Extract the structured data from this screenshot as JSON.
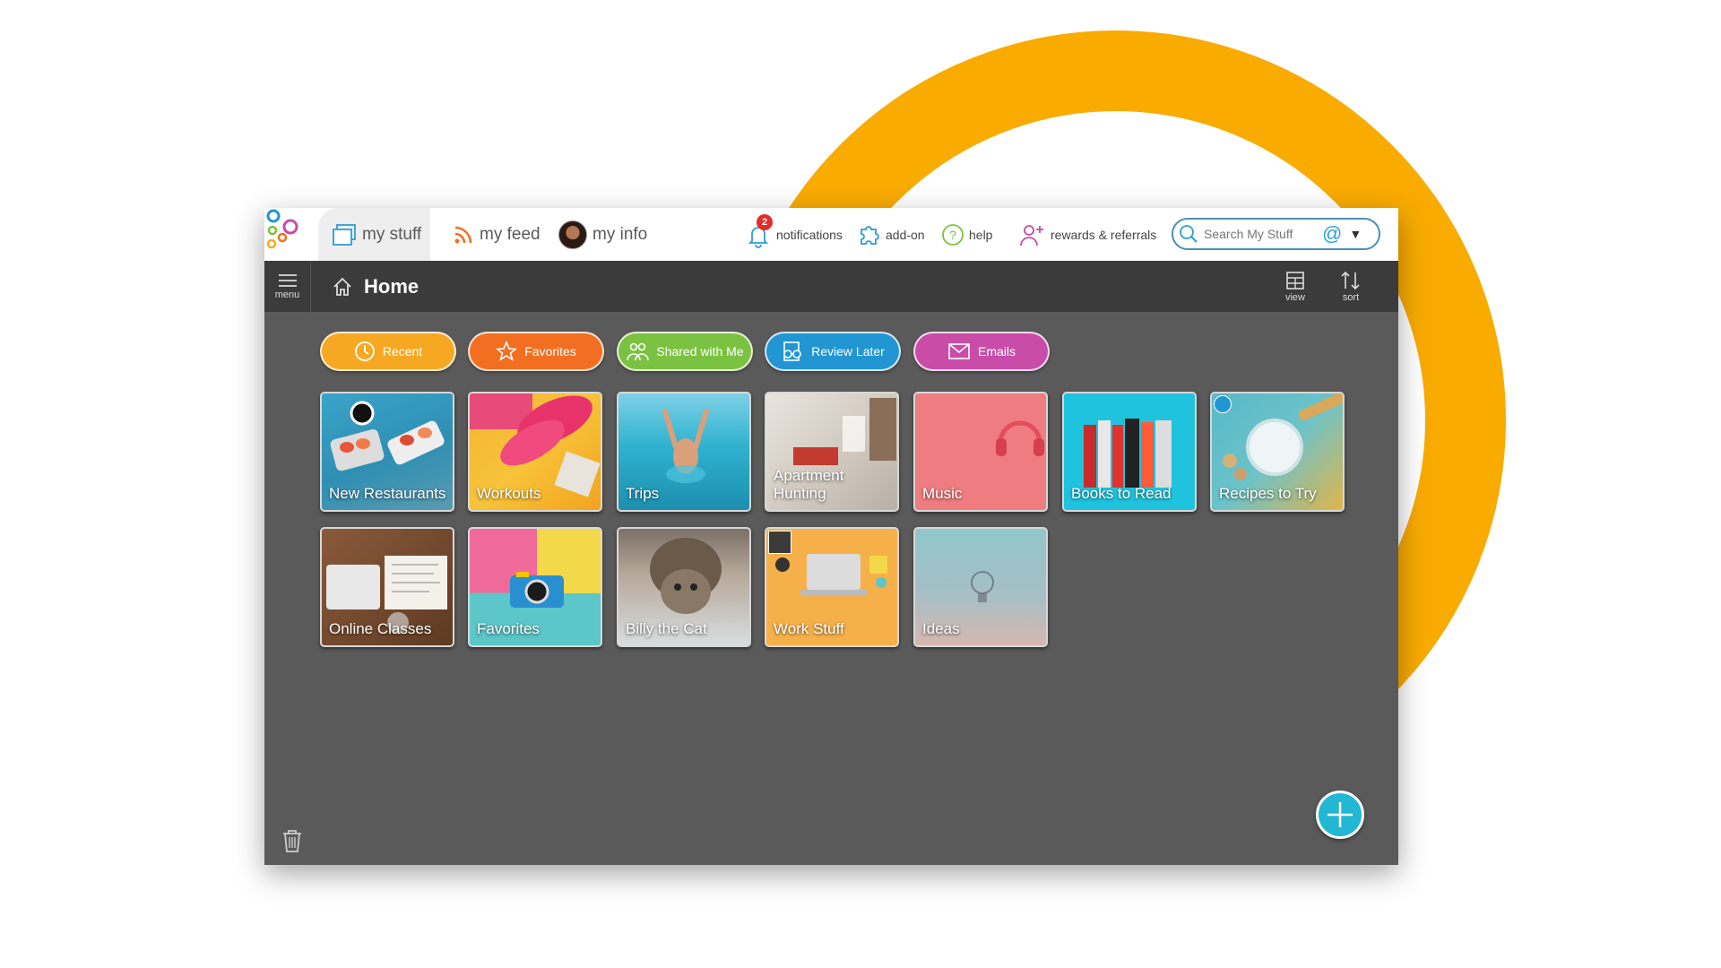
{
  "topnav": {
    "tabs": [
      {
        "label": "my stuff",
        "icon": "folders-icon"
      },
      {
        "label": "my feed",
        "icon": "rss-icon"
      },
      {
        "label": "my info",
        "icon": "avatar"
      }
    ],
    "links": [
      {
        "label": "notifications",
        "icon": "bell-icon",
        "badge": "2"
      },
      {
        "label": "add-on",
        "icon": "puzzle-icon"
      },
      {
        "label": "help",
        "icon": "help-icon"
      },
      {
        "label": "rewards & referrals",
        "icon": "add-user-icon"
      }
    ],
    "search": {
      "placeholder": "Search My Stuff",
      "at_symbol": "@",
      "caret": "▼"
    }
  },
  "header": {
    "menu_label": "menu",
    "title": "Home",
    "view_label": "view",
    "sort_label": "sort"
  },
  "filters": [
    {
      "label": "Recent",
      "color": "#F7A823"
    },
    {
      "label": "Favorites",
      "color": "#F26F21"
    },
    {
      "label": "Shared with Me",
      "color": "#7CC242"
    },
    {
      "label": "Review Later",
      "color": "#2196D3"
    },
    {
      "label": "Emails",
      "color": "#C84CA8"
    }
  ],
  "tiles": [
    {
      "label": "New Restaurants"
    },
    {
      "label": "Workouts"
    },
    {
      "label": "Trips"
    },
    {
      "label": "Apartment Hunting"
    },
    {
      "label": "Music"
    },
    {
      "label": "Books to Read"
    },
    {
      "label": "Recipes to Try"
    },
    {
      "label": "Online Classes"
    },
    {
      "label": "Favorites"
    },
    {
      "label": "Billy the Cat"
    },
    {
      "label": "Work Stuff"
    },
    {
      "label": "Ideas"
    }
  ],
  "colors": {
    "accent_ring": "#F9AB00",
    "fab": "#22b8d4",
    "header": "#3b3b3b",
    "canvas": "#5a5a5a"
  }
}
